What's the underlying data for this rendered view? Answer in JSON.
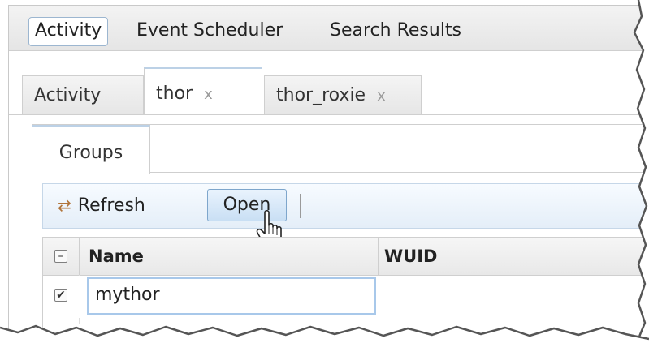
{
  "top_menu": {
    "items": [
      "Activity",
      "Event Scheduler",
      "Search Results"
    ],
    "active_index": 0
  },
  "outer_tabs": [
    {
      "label": "Activity",
      "closable": false,
      "selected": false
    },
    {
      "label": "thor",
      "closable": true,
      "selected": true,
      "close_glyph": "x"
    },
    {
      "label": "thor_roxie",
      "closable": true,
      "selected": false,
      "close_glyph": "x"
    }
  ],
  "inner_tabs": [
    {
      "label": "Groups",
      "selected": true
    }
  ],
  "toolbar": {
    "refresh_label": "Refresh",
    "refresh_icon": "refresh-icon",
    "open_label": "Open"
  },
  "grid": {
    "columns": [
      "Name",
      "WUID"
    ],
    "header_checkbox": "indeterminate",
    "rows": [
      {
        "checked": true,
        "name": "mythor",
        "wuid": ""
      }
    ]
  },
  "colors": {
    "accent_border": "#a8c8ea",
    "toolbar_bg": "#e4eef8",
    "refresh_icon": "#b0743a"
  }
}
